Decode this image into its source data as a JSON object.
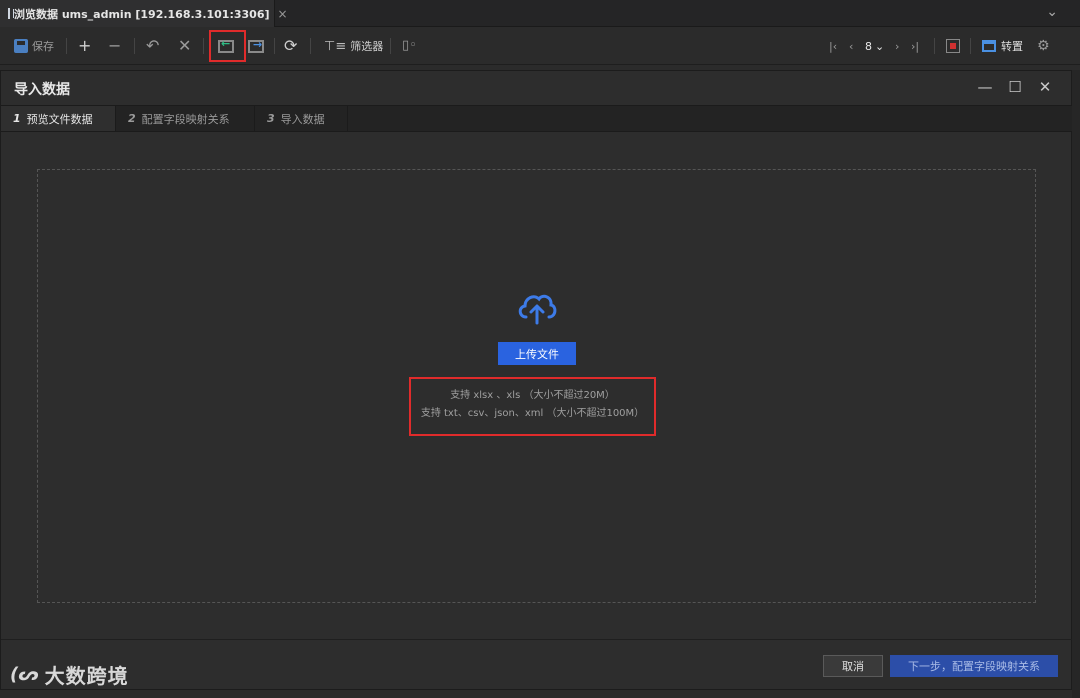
{
  "tab": {
    "title": "浏览数据 ums_admin [192.168.3.101:3306]",
    "close": "×",
    "dropdown": "⌄"
  },
  "toolbar": {
    "save_label": "保存",
    "filter_label": "筛选器",
    "page_number": "8",
    "transpose_label": "转置"
  },
  "dialog": {
    "title": "导入数据",
    "steps": [
      {
        "num": "1",
        "label": "预览文件数据"
      },
      {
        "num": "2",
        "label": "配置字段映射关系"
      },
      {
        "num": "3",
        "label": "导入数据"
      }
    ],
    "upload_label": "上传文件",
    "hint_excel": "支持 xlsx 、xls （大小不超过20M）",
    "hint_text": "支持 txt、csv、json、xml （大小不超过100M）",
    "cancel_label": "取消",
    "next_label": "下一步，配置字段映射关系"
  },
  "watermark": {
    "text": "大数跨境"
  },
  "colors": {
    "accent": "#2a63e0",
    "highlight": "#e02b2b",
    "background": "#2d2d2d"
  }
}
